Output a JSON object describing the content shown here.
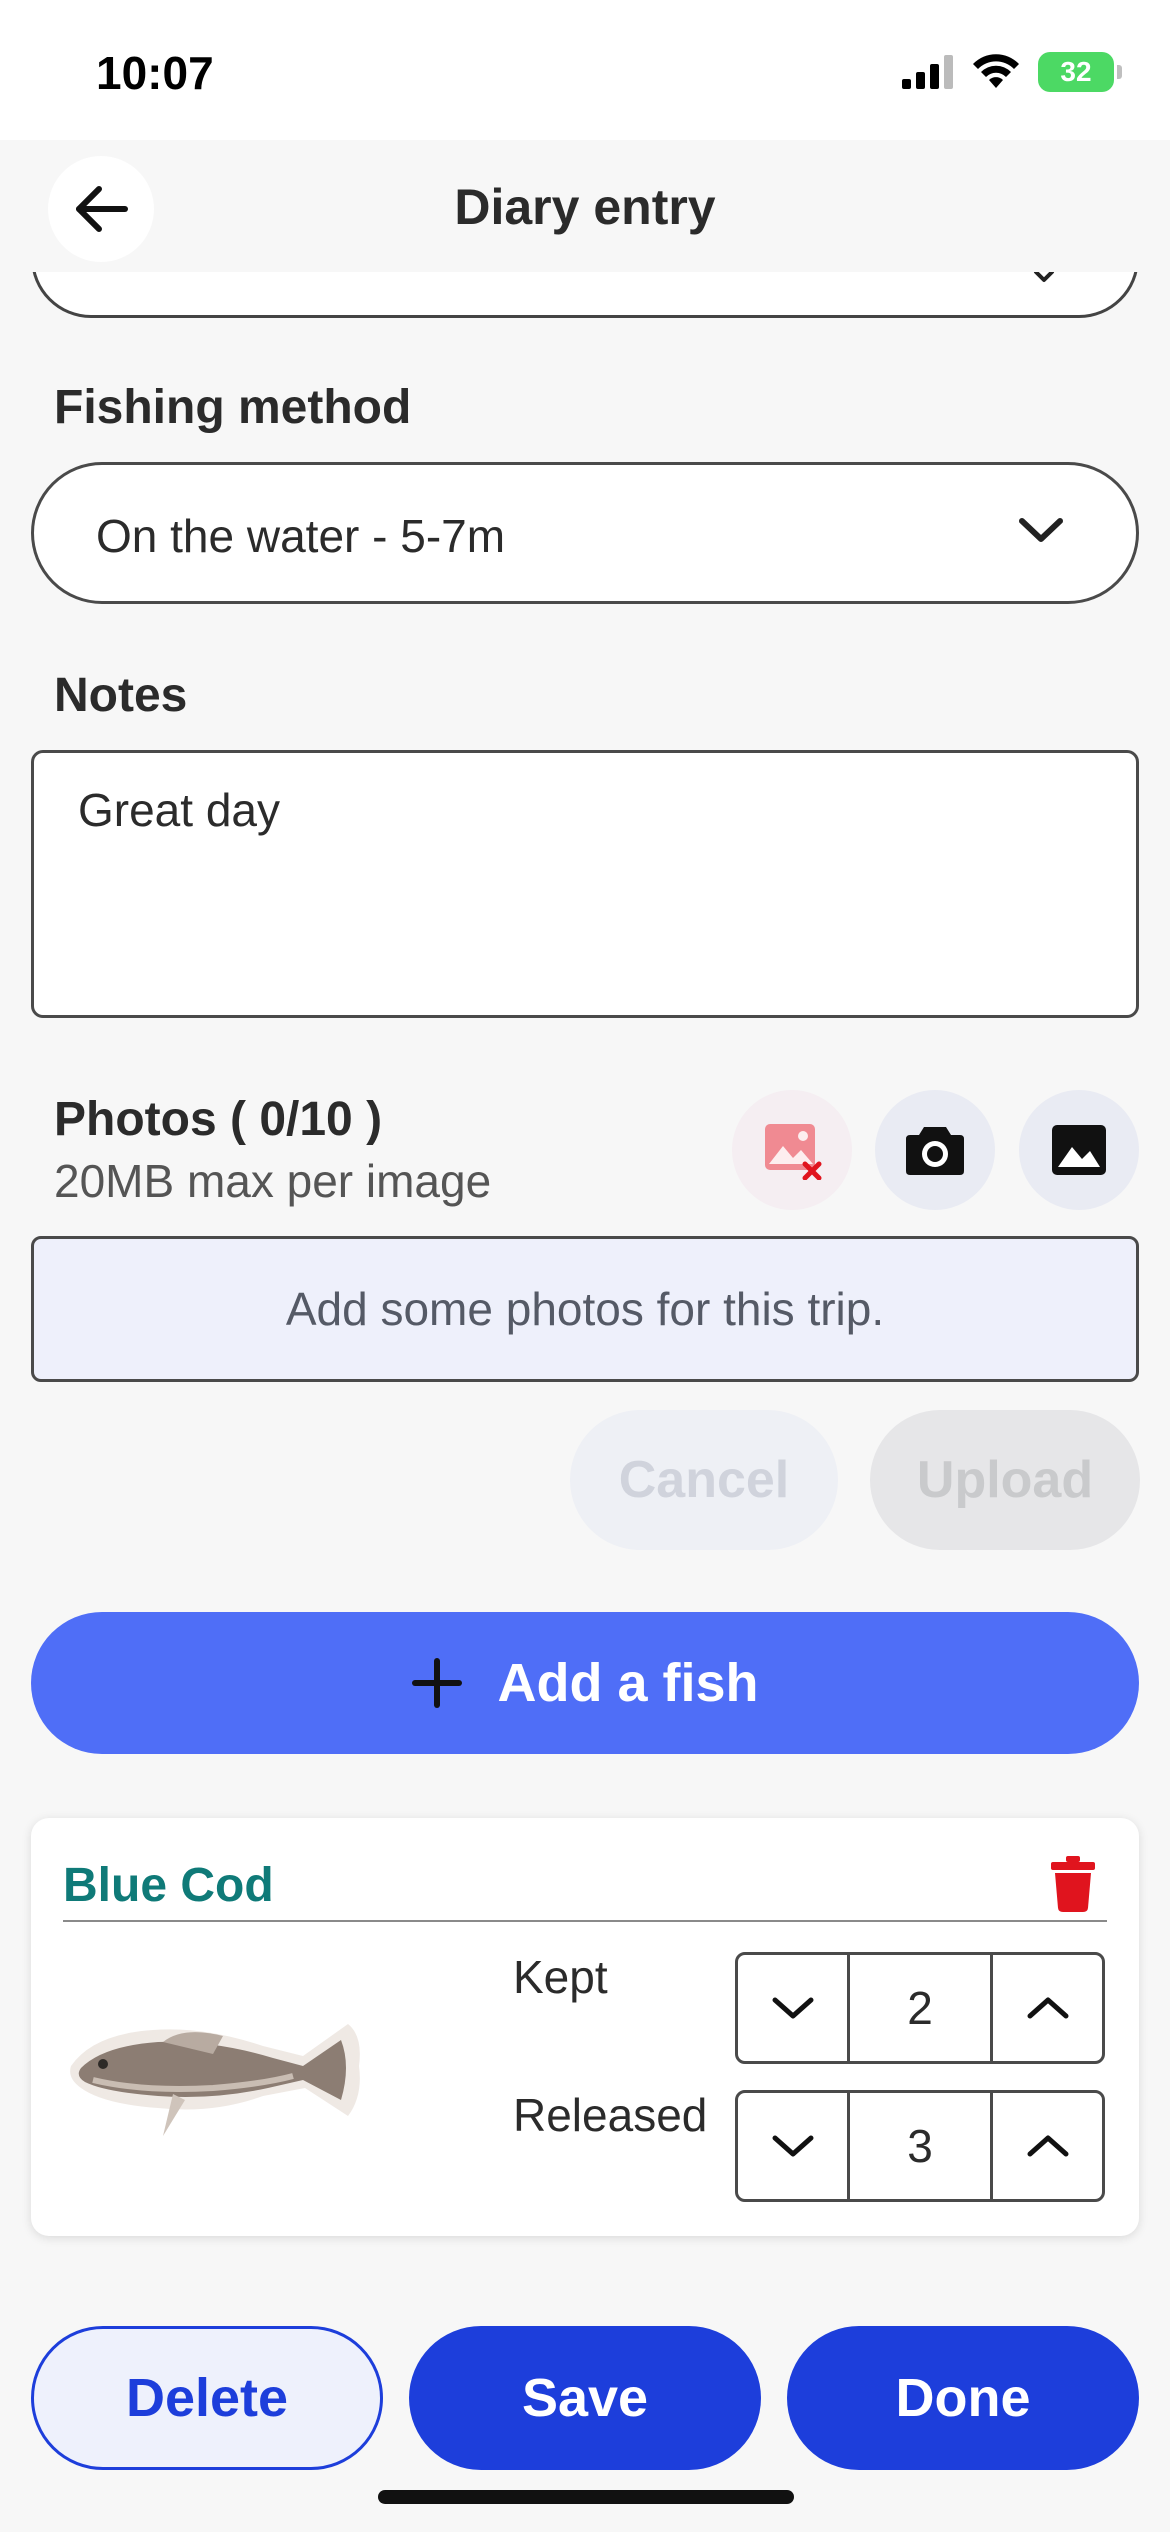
{
  "status_bar": {
    "time": "10:07",
    "battery": "32"
  },
  "nav": {
    "title": "Diary entry"
  },
  "fishing_method": {
    "label": "Fishing method",
    "value": "On the water - 5-7m"
  },
  "notes": {
    "label": "Notes",
    "value": "Great day"
  },
  "photos": {
    "title": "Photos ( 0/10 )",
    "subtitle": "20MB max per image",
    "placeholder": "Add some photos for this trip.",
    "cancel_label": "Cancel",
    "upload_label": "Upload"
  },
  "add_fish": {
    "label": "Add a fish"
  },
  "fish_card": {
    "name": "Blue Cod",
    "kept_label": "Kept",
    "kept_value": "2",
    "released_label": "Released",
    "released_value": "3"
  },
  "actions": {
    "delete_label": "Delete",
    "save_label": "Save",
    "done_label": "Done"
  },
  "colors": {
    "primary": "#1d3edb",
    "add_fish": "#4f6ef7",
    "fish_name": "#0f7a78",
    "danger": "#e0141e"
  }
}
